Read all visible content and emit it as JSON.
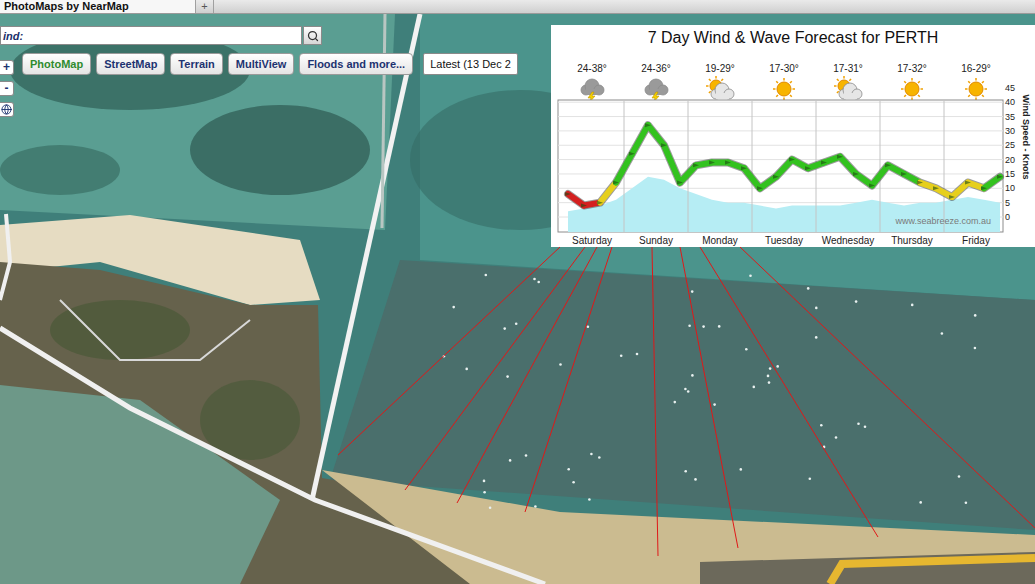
{
  "browser_tabs": [
    {
      "label": "PhotoMaps by NearMap",
      "selected": true
    }
  ],
  "new_tab_button": "+",
  "search": {
    "label": "ind:"
  },
  "zoom": {
    "in": "+",
    "out": "-"
  },
  "view_tabs": [
    {
      "label": "PhotoMap",
      "selected": true
    },
    {
      "label": "StreetMap",
      "selected": false
    },
    {
      "label": "Terrain",
      "selected": false
    },
    {
      "label": "MultiView",
      "selected": false
    },
    {
      "label": "Floods and more...",
      "selected": false
    }
  ],
  "date_select": {
    "value": "Latest (13 Dec 2"
  },
  "forecast_chart": {
    "title": "7 Day Wind & Wave Forecast for PERTH",
    "days": [
      {
        "day": "Saturday",
        "temps": "24-38°",
        "kind": "storm"
      },
      {
        "day": "Sunday",
        "temps": "24-36°",
        "kind": "storm"
      },
      {
        "day": "Monday",
        "temps": "19-29°",
        "kind": "partly-cloudy"
      },
      {
        "day": "Tuesday",
        "temps": "17-30°",
        "kind": "sunny"
      },
      {
        "day": "Wednesday",
        "temps": "17-31°",
        "kind": "partly-cloudy"
      },
      {
        "day": "Thursday",
        "temps": "17-32°",
        "kind": "sunny"
      },
      {
        "day": "Friday",
        "temps": "16-29°",
        "kind": "sunny"
      }
    ],
    "y_axis": {
      "label": "Wind Speed - Knots",
      "ticks": [
        "45",
        "40",
        "35",
        "30",
        "25",
        "20",
        "15",
        "10",
        "5",
        "0"
      ]
    },
    "series": [
      {
        "name": "wind",
        "values": [
          8,
          4,
          5,
          12,
          22,
          32,
          25,
          12,
          18,
          19,
          19,
          17,
          10,
          14,
          20,
          17,
          19,
          21,
          15,
          11,
          18,
          15,
          12,
          10,
          7,
          12,
          10,
          14
        ]
      },
      {
        "name": "wave",
        "values": [
          2,
          3,
          4,
          6,
          10,
          14,
          13,
          10,
          8,
          6,
          5,
          5,
          4,
          3,
          4,
          4,
          4,
          4,
          5,
          6,
          5,
          4,
          5,
          5,
          6,
          7,
          6,
          5
        ]
      }
    ],
    "credit": "www.seabreeze.com.au"
  }
}
